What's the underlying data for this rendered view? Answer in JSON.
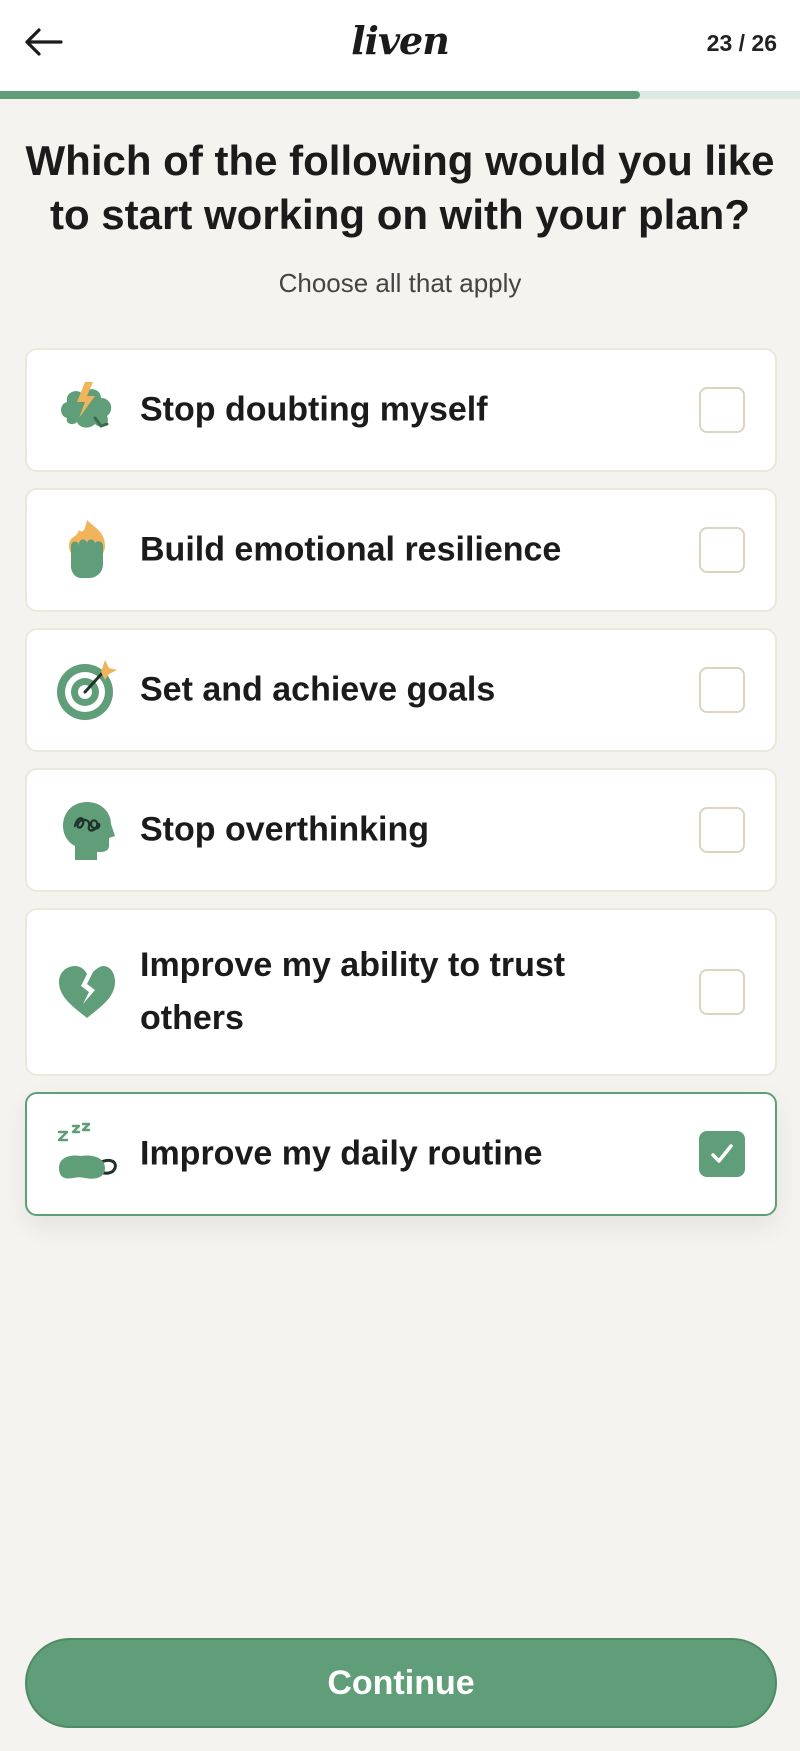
{
  "header": {
    "logo": "liven",
    "step": "23 / 26",
    "progress_fraction": 0.8
  },
  "question": {
    "title": "Which of the following would you like to start working on with your plan?",
    "subtitle": "Choose all that apply"
  },
  "options": [
    {
      "label": "Stop doubting myself",
      "icon": "brain-lightning-icon",
      "checked": false
    },
    {
      "label": "Build emotional resilience",
      "icon": "fist-flame-icon",
      "checked": false
    },
    {
      "label": "Set and achieve goals",
      "icon": "target-arrow-icon",
      "checked": false
    },
    {
      "label": "Stop overthinking",
      "icon": "head-scribble-icon",
      "checked": false
    },
    {
      "label": "Improve my ability to trust others",
      "icon": "broken-heart-icon",
      "checked": false
    },
    {
      "label": "Improve my daily routine",
      "icon": "sleep-mask-icon",
      "checked": true
    }
  ],
  "continue_label": "Continue",
  "colors": {
    "accent": "#5f9e78",
    "background": "#f4f3ef",
    "checkbox_border": "#dbd5bf",
    "icon_orange": "#f0b55c"
  }
}
